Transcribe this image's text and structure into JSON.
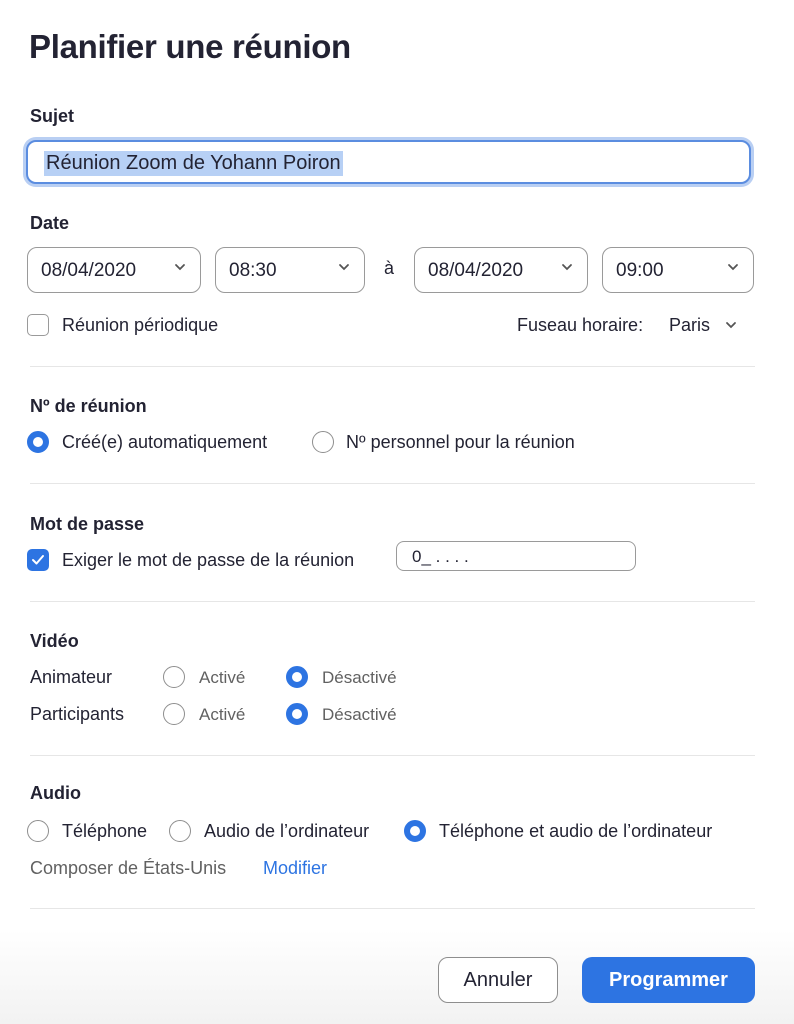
{
  "title": "Planifier une réunion",
  "subject": {
    "label": "Sujet",
    "value": "Réunion Zoom de Yohann Poiron"
  },
  "date": {
    "label": "Date",
    "start_date": "08/04/2020",
    "start_time": "08:30",
    "to_label": "à",
    "end_date": "08/04/2020",
    "end_time": "09:00",
    "recurring_label": "Réunion périodique",
    "recurring_checked": false,
    "timezone_label": "Fuseau horaire:",
    "timezone_value": "Paris"
  },
  "meeting_id": {
    "label": "Nº de réunion",
    "options": [
      {
        "label": "Créé(e) automatiquement",
        "selected": true
      },
      {
        "label": "Nº personnel pour la réunion",
        "selected": false
      }
    ]
  },
  "password": {
    "label": "Mot de passe",
    "require_label": "Exiger le mot de passe de la réunion",
    "require_checked": true,
    "value": "0_ . . . ."
  },
  "video": {
    "label": "Vidéo",
    "host_label": "Animateur",
    "participants_label": "Participants",
    "on_label": "Activé",
    "off_label": "Désactivé",
    "host_value": "off",
    "participants_value": "off"
  },
  "audio": {
    "label": "Audio",
    "options": [
      {
        "label": "Téléphone",
        "selected": false
      },
      {
        "label": "Audio de l’ordinateur",
        "selected": false
      },
      {
        "label": "Téléphone et audio de l’ordinateur",
        "selected": true
      }
    ],
    "dial_from": "Composer de États-Unis",
    "edit_link": "Modifier"
  },
  "buttons": {
    "cancel": "Annuler",
    "schedule": "Programmer"
  },
  "colors": {
    "accent": "#2d74e2",
    "text": "#232333",
    "muted": "#616161"
  }
}
